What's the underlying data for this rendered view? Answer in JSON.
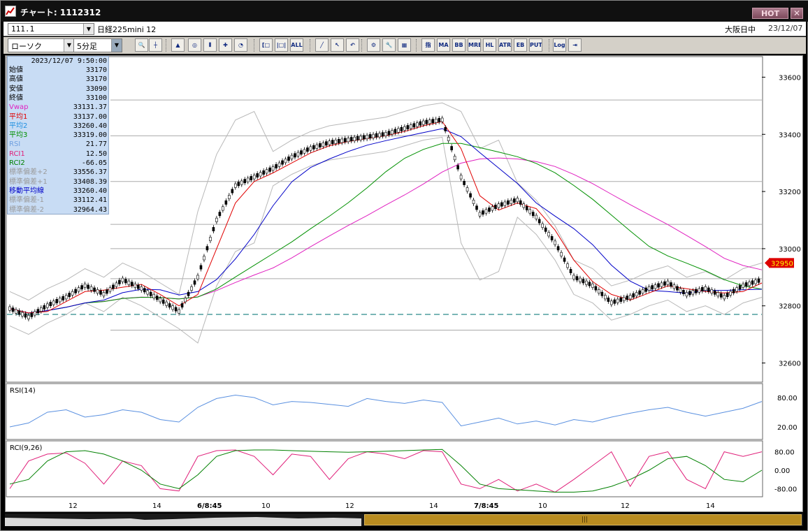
{
  "window": {
    "title": "チャート: 1112312"
  },
  "titlebar_buttons": {
    "hot": "HOT",
    "close": "✕"
  },
  "symbol_bar": {
    "symbol": "111.1",
    "name": "日経225mini 12",
    "market": "大阪日中",
    "date": "23/12/07"
  },
  "toolbar": {
    "chart_type": "ローソク",
    "period": "5分足",
    "buttons": [
      {
        "icon": "zoom-icon",
        "label": "🔍"
      },
      {
        "icon": "cursor-line-icon",
        "label": "┼"
      },
      {
        "icon": "bar-chart-icon",
        "label": "▲"
      },
      {
        "icon": "magnify-icon",
        "label": "◎"
      },
      {
        "icon": "candlestick-icon",
        "label": "⫴"
      },
      {
        "icon": "crosshair-icon",
        "label": "✚"
      },
      {
        "icon": "clock-icon",
        "label": "◔"
      },
      {
        "icon": "bracket-left-icon",
        "label": "[□"
      },
      {
        "icon": "bracket-both-icon",
        "label": "|□|"
      },
      {
        "icon": "all-icon",
        "label": "ALL"
      },
      {
        "icon": "draw-line-icon",
        "label": "╱"
      },
      {
        "icon": "pointer-icon",
        "label": "↖"
      },
      {
        "icon": "undo-icon",
        "label": "↶"
      },
      {
        "icon": "settings-icon",
        "label": "⚙"
      },
      {
        "icon": "wrench-icon",
        "label": "🔧"
      },
      {
        "icon": "color-icon",
        "label": "▦"
      },
      {
        "icon": "indicator-icon",
        "label": "指"
      },
      {
        "icon": "ma-icon",
        "label": "MA"
      },
      {
        "icon": "bb-icon",
        "label": "BB"
      },
      {
        "icon": "mre-icon",
        "label": "MRE"
      },
      {
        "icon": "hl-icon",
        "label": "HL"
      },
      {
        "icon": "atr-icon",
        "label": "ATR"
      },
      {
        "icon": "ebsa-icon",
        "label": "EB"
      },
      {
        "icon": "put-icon",
        "label": "PUT"
      },
      {
        "icon": "log-icon",
        "label": "Log"
      },
      {
        "icon": "export-icon",
        "label": "⇥"
      }
    ]
  },
  "info_panel": {
    "datetime": "2023/12/07 9:50:00",
    "rows": [
      {
        "label": "始値",
        "value": "33170",
        "color": "#000000"
      },
      {
        "label": "高値",
        "value": "33170",
        "color": "#000000"
      },
      {
        "label": "安値",
        "value": "33090",
        "color": "#000000"
      },
      {
        "label": "終値",
        "value": "33100",
        "color": "#000000"
      },
      {
        "label": "Vwap",
        "value": "33131.37",
        "color": "#e020c0"
      },
      {
        "label": "平均1",
        "value": "33137.00",
        "color": "#e00000"
      },
      {
        "label": "平均2",
        "value": "33260.40",
        "color": "#2090e0"
      },
      {
        "label": "平均3",
        "value": "33319.00",
        "color": "#009000"
      },
      {
        "label": "RSI",
        "value": "21.77",
        "color": "#6fa0e0"
      },
      {
        "label": "RCI1",
        "value": "12.50",
        "color": "#e0207a"
      },
      {
        "label": "RCI2",
        "value": "-66.05",
        "color": "#008000"
      },
      {
        "label": "標準偏差+2",
        "value": "33556.37",
        "color": "#9a9a9a"
      },
      {
        "label": "標準偏差+1",
        "value": "33408.39",
        "color": "#9a9a9a"
      },
      {
        "label": "移動平均線",
        "value": "33260.40",
        "color": "#0000c8"
      },
      {
        "label": "標準偏差-1",
        "value": "33112.41",
        "color": "#9a9a9a"
      },
      {
        "label": "標準偏差-2",
        "value": "32964.43",
        "color": "#9a9a9a"
      }
    ]
  },
  "chart_data": [
    {
      "type": "candlestick",
      "panel": "price",
      "y_ticks": [
        "33600",
        "33400",
        "33200",
        "33000",
        "32800",
        "32600"
      ],
      "ylim": [
        32550,
        33650
      ],
      "current_price_label": "32950",
      "dashed_reference": 32770,
      "horizontal_levels": [
        33520,
        33395,
        33235,
        33085,
        33000,
        32895,
        32715
      ],
      "x_labels": [
        "12",
        "14",
        "6/8:45",
        "10",
        "12",
        "14",
        "7/8:45",
        "10",
        "12",
        "14"
      ],
      "day_labels_bold": [
        "6/8:45",
        "7/8:45"
      ],
      "close_path": [
        32790,
        32760,
        32800,
        32830,
        32870,
        32840,
        32890,
        32860,
        32820,
        32780,
        32900,
        33100,
        33220,
        33250,
        33280,
        33320,
        33350,
        33370,
        33380,
        33390,
        33400,
        33420,
        33440,
        33450,
        33250,
        33120,
        33150,
        33170,
        33110,
        33020,
        32900,
        32870,
        32810,
        32830,
        32860,
        32880,
        32840,
        32860,
        32830,
        32870,
        32890
      ],
      "series": [
        {
          "name": "Vwap",
          "color": "#e020c0"
        },
        {
          "name": "平均1",
          "color": "#e00000"
        },
        {
          "name": "移動平均線",
          "color": "#0000c8"
        },
        {
          "name": "平均3",
          "color": "#009000"
        },
        {
          "name": "標準偏差",
          "color": "#b0b0b0"
        }
      ]
    },
    {
      "type": "line",
      "panel": "rsi",
      "title": "RSI(14)",
      "y_ticks": [
        "80.00",
        "20.00"
      ],
      "values": [
        20,
        28,
        50,
        55,
        40,
        45,
        55,
        50,
        35,
        30,
        60,
        78,
        85,
        80,
        65,
        72,
        70,
        66,
        62,
        78,
        72,
        68,
        75,
        70,
        22,
        30,
        38,
        26,
        32,
        24,
        35,
        30,
        40,
        48,
        55,
        60,
        50,
        42,
        50,
        58,
        72
      ]
    },
    {
      "type": "line",
      "panel": "rci",
      "title": "RCI(9,26)",
      "y_ticks": [
        "80.00",
        "0.00",
        "-80.00"
      ],
      "series": [
        {
          "name": "RCI1",
          "values": [
            -80,
            40,
            70,
            75,
            30,
            -60,
            40,
            20,
            -80,
            -90,
            60,
            85,
            88,
            60,
            -20,
            70,
            60,
            -40,
            50,
            80,
            70,
            50,
            85,
            80,
            -60,
            -80,
            -40,
            -90,
            -60,
            -95,
            -40,
            20,
            80,
            -70,
            60,
            80,
            -40,
            -80,
            80,
            60,
            80
          ]
        },
        {
          "name": "RCI2",
          "values": [
            -60,
            -40,
            40,
            80,
            85,
            70,
            40,
            0,
            -60,
            -80,
            -20,
            60,
            85,
            88,
            88,
            85,
            82,
            80,
            78,
            80,
            82,
            85,
            88,
            90,
            20,
            -60,
            -80,
            -85,
            -90,
            -95,
            -95,
            -90,
            -70,
            -40,
            0,
            50,
            60,
            20,
            -40,
            -50,
            0
          ]
        }
      ]
    }
  ]
}
